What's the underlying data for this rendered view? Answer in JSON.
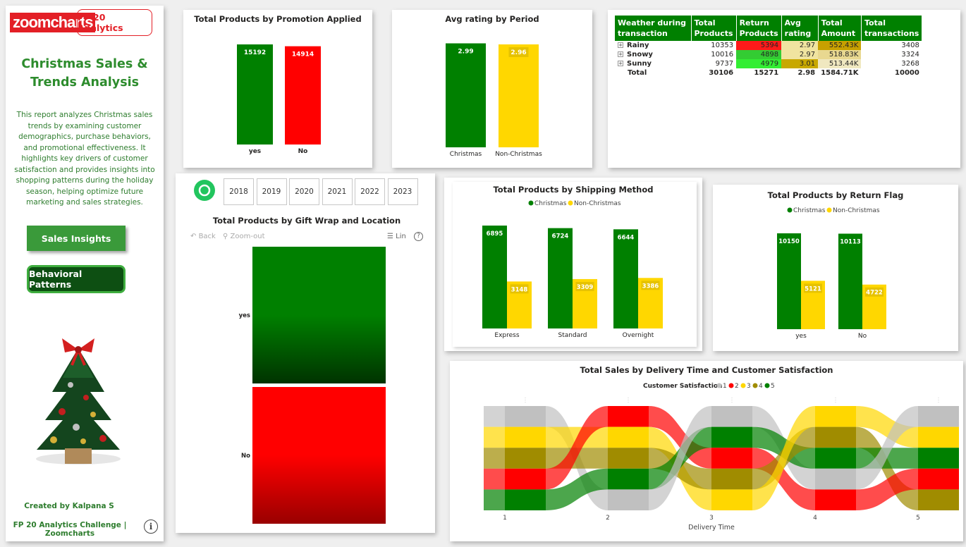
{
  "sidebar": {
    "logo": "zoomcharts",
    "badge": "FP 20 Analytics",
    "title_line1": "Christmas Sales &",
    "title_line2": "Trends Analysis",
    "description": "This report analyzes Christmas sales trends by examining customer demographics, purchase behaviors, and promotional effectiveness. It highlights key drivers of customer satisfaction and provides insights into shopping patterns during the holiday season, helping optimize future marketing and sales strategies.",
    "btn_sales": "Sales Insights",
    "btn_behavior": "Behavioral Patterns",
    "created": "Created by Kalpana S",
    "footer": "FP 20 Analytics Challenge | Zoomcharts",
    "info": "i"
  },
  "colors": {
    "green": "#008000",
    "red": "#ff0000",
    "yellow": "#ffd700",
    "gray": "#c0c0c0",
    "olive": "#a08c00"
  },
  "years": [
    "2018",
    "2019",
    "2020",
    "2021",
    "2022",
    "2023"
  ],
  "toolbar": {
    "back": "Back",
    "zoom_out": "Zoom-out",
    "lin": "Lin",
    "help": "?"
  },
  "chart_data": [
    {
      "type": "bar",
      "title": "Total Products by Promotion Applied",
      "categories": [
        "yes",
        "No"
      ],
      "values": [
        15192,
        14914
      ]
    },
    {
      "type": "bar",
      "title": "Avg rating by Period",
      "categories": [
        "Christmas",
        "Non-Christmas"
      ],
      "values": [
        2.99,
        2.96
      ]
    },
    {
      "type": "table",
      "columns": [
        "Weather during transaction",
        "Total Products",
        "Return Products",
        "Avg rating",
        "Total Amount",
        "Total transactions"
      ],
      "rows": [
        [
          "Rainy",
          "10353",
          "5394",
          "2.97",
          "552.43K",
          "3408"
        ],
        [
          "Snowy",
          "10016",
          "4898",
          "2.97",
          "518.83K",
          "3324"
        ],
        [
          "Sunny",
          "9737",
          "4979",
          "3.01",
          "513.44K",
          "3268"
        ]
      ],
      "total": [
        "Total",
        "30106",
        "15271",
        "2.98",
        "1584.71K",
        "10000"
      ]
    },
    {
      "type": "bar",
      "title": "Total Products by Shipping Method",
      "categories": [
        "Express",
        "Standard",
        "Overnight"
      ],
      "series": [
        {
          "name": "Christmas",
          "values": [
            6895,
            6724,
            6644
          ]
        },
        {
          "name": "Non-Christmas",
          "values": [
            3148,
            3309,
            3386
          ]
        }
      ]
    },
    {
      "type": "bar",
      "title": "Total Products by Return Flag",
      "categories": [
        "yes",
        "No"
      ],
      "series": [
        {
          "name": "Christmas",
          "values": [
            10150,
            10113
          ]
        },
        {
          "name": "Non-Christmas",
          "values": [
            5121,
            4722
          ]
        }
      ]
    },
    {
      "type": "bar",
      "title": "Total Products by Gift Wrap and Location",
      "categories": [
        "yes",
        "No"
      ]
    },
    {
      "type": "area",
      "title": "Total Sales by Delivery Time and Customer Satisfaction",
      "xlabel": "Delivery Time",
      "legend_title": "Customer Satisfaction",
      "x": [
        "1",
        "2",
        "3",
        "4",
        "5"
      ],
      "satisfaction_levels": [
        "1",
        "2",
        "3",
        "4",
        "5"
      ]
    }
  ]
}
